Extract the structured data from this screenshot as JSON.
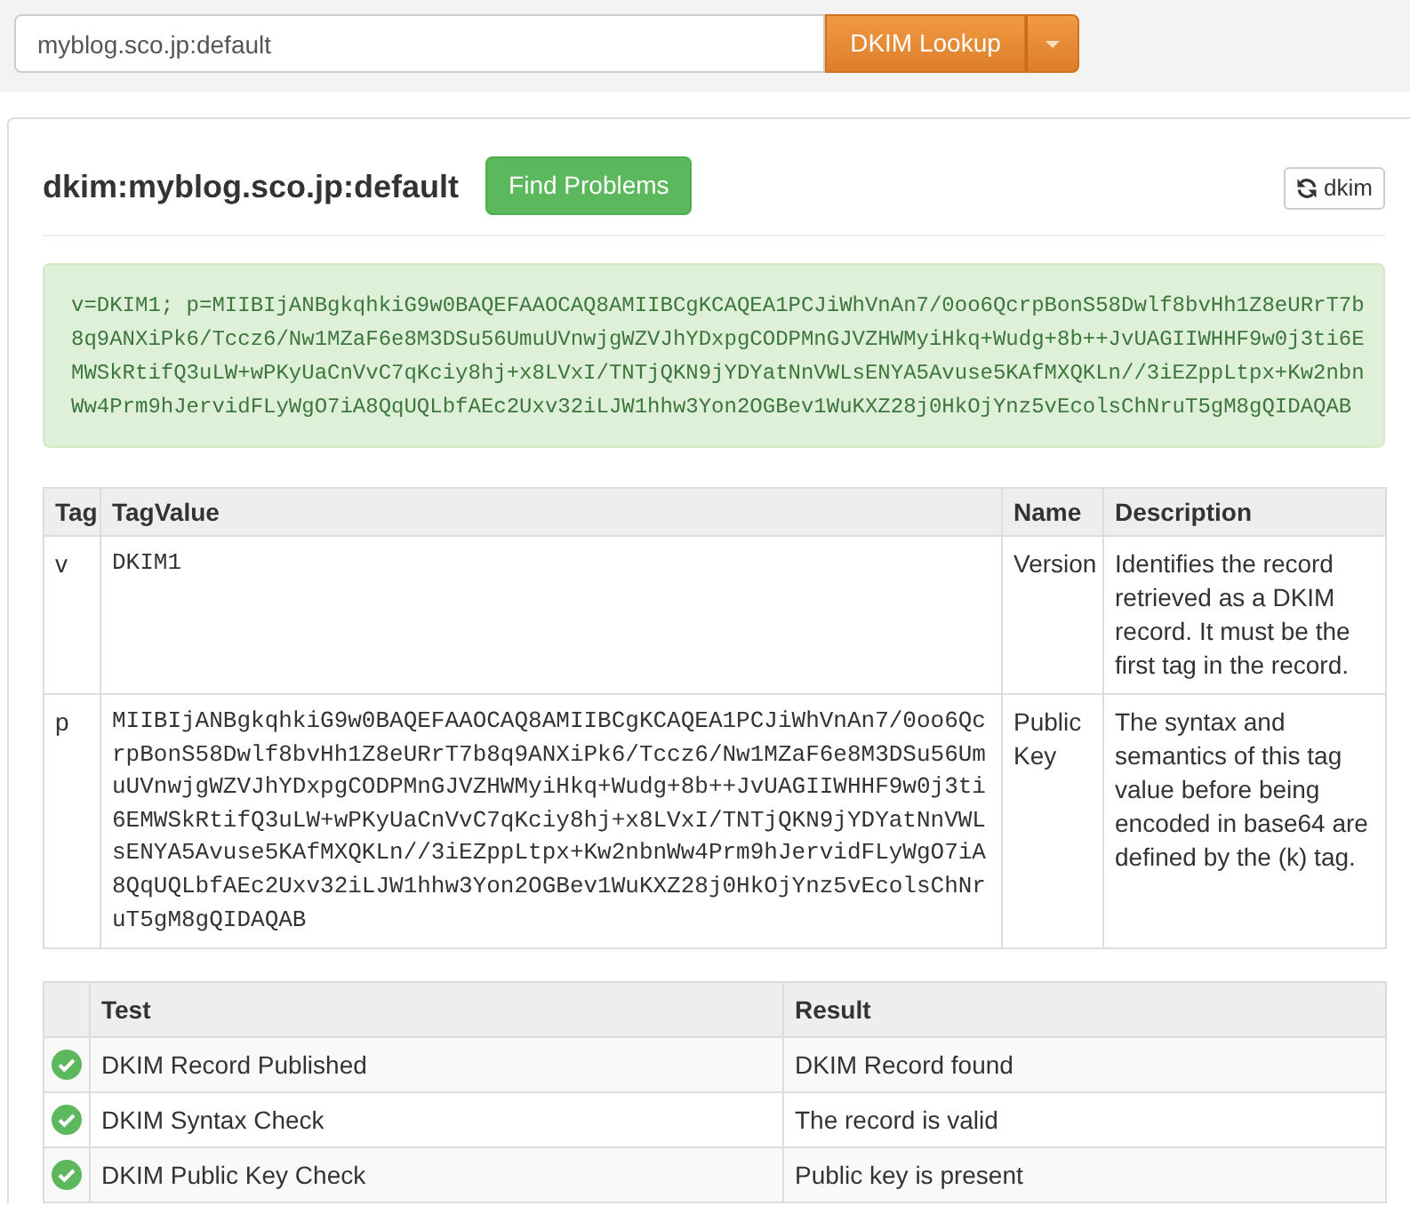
{
  "search": {
    "value": "myblog.sco.jp:default",
    "button": "DKIM Lookup"
  },
  "header": {
    "title": "dkim:myblog.sco.jp:default",
    "find_button": "Find Problems",
    "refresh_button": "dkim"
  },
  "record": "v=DKIM1; p=MIIBIjANBgkqhkiG9w0BAQEFAAOCAQ8AMIIBCgKCAQEA1PCJiWhVnAn7/0oo6QcrpBonS58Dwlf8bvHh1Z8eURrT7b8q9ANXiPk6/Tccz6/Nw1MZaF6e8M3DSu56UmuUVnwjgWZVJhYDxpgCODPMnGJVZHWMyiHkq+Wudg+8b++JvUAGIIWHHF9w0j3ti6EMWSkRtifQ3uLW+wPKyUaCnVvC7qKciy8hj+x8LVxI/TNTjQKN9jYDYatNnVWLsENYA5Avuse5KAfMXQKLn//3iEZppLtpx+Kw2nbnWw4Prm9hJervidFLyWgO7iA8QqUQLbfAEc2Uxv32iLJW1hhw3Yon2OGBev1WuKXZ28j0HkOjYnz5vEcolsChNruT5gM8gQIDAQAB",
  "tag_table": {
    "columns": [
      "Tag",
      "TagValue",
      "Name",
      "Description"
    ],
    "rows": [
      {
        "tag": "v",
        "value": "DKIM1",
        "name": "Version",
        "description": "Identifies the record retrieved as a DKIM record. It must be the first tag in the record."
      },
      {
        "tag": "p",
        "value": "MIIBIjANBgkqhkiG9w0BAQEFAAOCAQ8AMIIBCgKCAQEA1PCJiWhVnAn7/0oo6QcrpBonS58Dwlf8bvHh1Z8eURrT7b8q9ANXiPk6/Tccz6/Nw1MZaF6e8M3DSu56UmuUVnwjgWZVJhYDxpgCODPMnGJVZHWMyiHkq+Wudg+8b++JvUAGIIWHHF9w0j3ti6EMWSkRtifQ3uLW+wPKyUaCnVvC7qKciy8hj+x8LVxI/TNTjQKN9jYDYatNnVWLsENYA5Avuse5KAfMXQKLn//3iEZppLtpx+Kw2nbnWw4Prm9hJervidFLyWgO7iA8QqUQLbfAEc2Uxv32iLJW1hhw3Yon2OGBev1WuKXZ28j0HkOjYnz5vEcolsChNruT5gM8gQIDAQAB",
        "name": "Public Key",
        "description": "The syntax and semantics of this tag value before being encoded in base64 are defined by the (k) tag."
      }
    ]
  },
  "tests": {
    "columns": [
      "Test",
      "Result"
    ],
    "rows": [
      {
        "passed": true,
        "test": "DKIM Record Published",
        "result": "DKIM Record found"
      },
      {
        "passed": true,
        "test": "DKIM Syntax Check",
        "result": "The record is valid"
      },
      {
        "passed": true,
        "test": "DKIM Public Key Check",
        "result": "Public key is present"
      }
    ]
  }
}
